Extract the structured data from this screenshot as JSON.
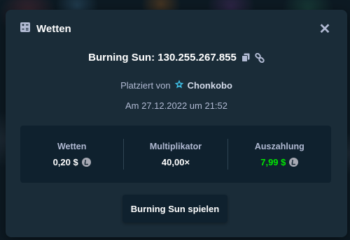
{
  "modal": {
    "title": "Wetten",
    "title_icon": "bets-list-icon",
    "close_icon": "close-icon",
    "close_glyph": "✕"
  },
  "bet": {
    "game_id_text": "Burning Sun: 130.255.267.855",
    "placed_by_label": "Platziert von",
    "user": "Chonkobo",
    "user_icon": "vip-star-icon",
    "date": "Am 27.12.2022 um 21:52"
  },
  "stats": {
    "bet_label": "Wetten",
    "bet_value": "0,20 $",
    "multiplier_label": "Multiplikator",
    "multiplier_value": "40,00×",
    "payout_label": "Auszahlung",
    "payout_value": "7,99 $",
    "currency_icon": "litecoin-icon"
  },
  "actions": {
    "play_label": "Burning Sun spielen"
  },
  "colors": {
    "modal_bg": "#1a2c38",
    "panel_bg": "#0f212e",
    "muted_text": "#b1bad3",
    "win_green": "#00e701",
    "vip_star": "#3fc1e8"
  }
}
